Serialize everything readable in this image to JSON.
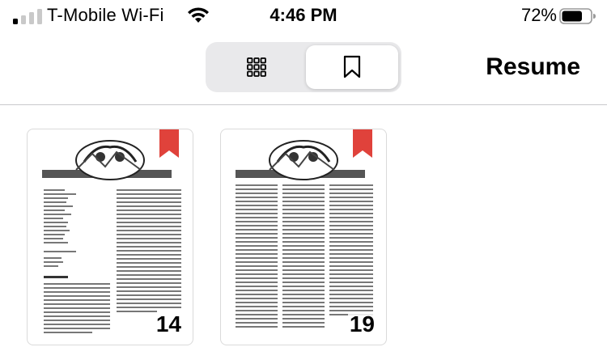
{
  "status_bar": {
    "carrier": "T-Mobile Wi-Fi",
    "time": "4:46 PM",
    "battery_percent": "72%",
    "signal_bars_filled": 1,
    "battery_level": 0.72
  },
  "toolbar": {
    "segments": [
      {
        "icon": "grid-icon",
        "selected": false
      },
      {
        "icon": "bookmark-icon",
        "selected": true
      }
    ],
    "resume_label": "Resume"
  },
  "pages": [
    {
      "number": "14",
      "bookmarked": true
    },
    {
      "number": "19",
      "bookmarked": true
    }
  ],
  "colors": {
    "ribbon": "#e0423b",
    "segment_bg": "#e9e9eb",
    "divider": "#c8c8cc"
  }
}
